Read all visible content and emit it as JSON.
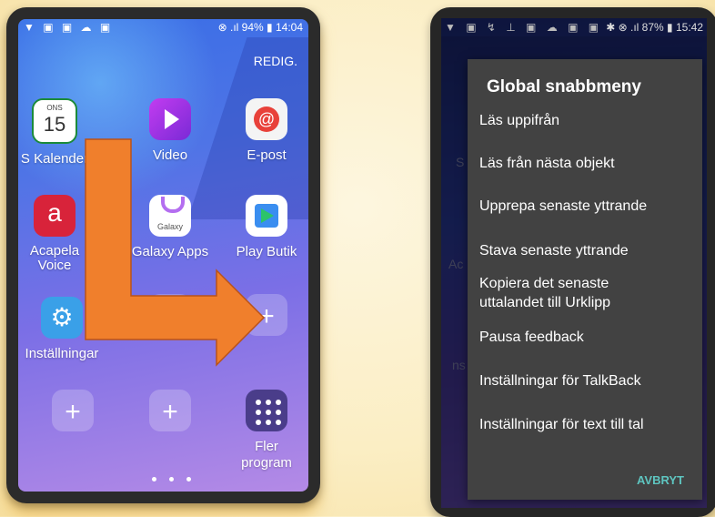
{
  "left_phone": {
    "status": {
      "icons": "▼ ▣ ▣ ☁ ▣",
      "right": "⊗ .ıl 94% ▮ 14:04"
    },
    "edit_label": "REDIG.",
    "calendar_day_abbr": "ONS",
    "calendar_day": "15",
    "apps": {
      "calendar": "S Kalender",
      "video": "Video",
      "email": "E-post",
      "acapela": "Acapela\nVoice",
      "galaxy_apps": "Galaxy Apps",
      "galaxy_icon_text": "Galaxy",
      "play": "Play Butik",
      "settings": "Inställningar",
      "more": "Fler\nprogram"
    },
    "arrow_color": "#f07f2c"
  },
  "right_phone": {
    "status": {
      "icons": "▼ ▣ ↯ ⊥ ▣ ☁ ▣ ▣",
      "right": "✱ ⊗ .ıl 87% ▮ 15:42"
    },
    "bg_fragments": {
      "s": "S",
      "ac": "Ac",
      "k": "k",
      "ns": "ns"
    },
    "menu": {
      "title": "Global snabbmeny",
      "items": [
        "Läs uppifrån",
        "Läs från nästa objekt",
        "Upprepa senaste yttrande",
        "Stava senaste yttrande",
        "Kopiera det senaste\nuttalandet till Urklipp",
        "Pausa feedback",
        "Inställningar för TalkBack",
        "Inställningar för text till tal"
      ],
      "cancel": "AVBRYT"
    }
  }
}
